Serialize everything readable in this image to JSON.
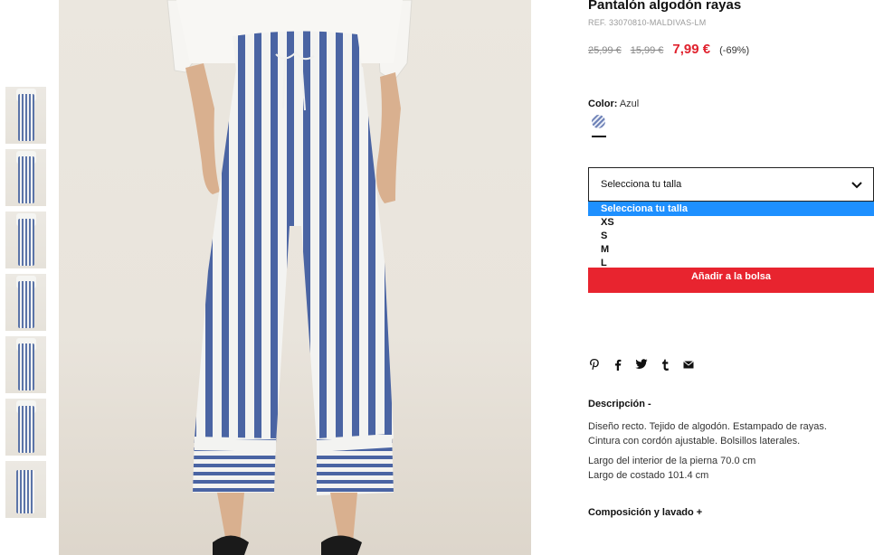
{
  "product": {
    "title": "Pantalón algodón rayas",
    "ref": "REF. 33070810-MALDIVAS-LM",
    "price_original_1": "25,99 €",
    "price_original_2": "15,99 €",
    "price_current": "7,99 €",
    "discount": "(-69%)"
  },
  "color": {
    "label": "Color:",
    "value": "Azul",
    "swatch_colors": [
      "#6e82b7",
      "#e9edf6"
    ]
  },
  "size_select": {
    "selected": "Selecciona tu talla",
    "options": [
      "Selecciona tu talla",
      "XS",
      "S",
      "M",
      "L"
    ]
  },
  "add_to_bag": "Añadir a la bolsa",
  "social_icons": [
    "pinterest-icon",
    "facebook-icon",
    "twitter-icon",
    "tumblr-icon",
    "email-icon"
  ],
  "description": {
    "title": "Descripción -",
    "line1": "Diseño recto. Tejido de algodón. Estampado de rayas.",
    "line2": "Cintura con cordón ajustable. Bolsillos laterales.",
    "line3": "Largo del interior de la pierna 70.0 cm",
    "line4": "Largo de costado 101.4 cm"
  },
  "composition": "Composición y lavado +",
  "thumbnail_count": 7,
  "colors": {
    "accent_red": "#e8242f",
    "price_red": "#e0222e",
    "stripe_blue": "#4a64a3",
    "select_highlight": "#1e90ff"
  }
}
